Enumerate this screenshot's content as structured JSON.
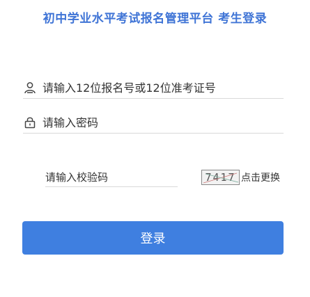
{
  "page": {
    "title": "初中学业水平考试报名管理平台 考生登录"
  },
  "login": {
    "username_placeholder": "请输入12位报名号或12位准考证号",
    "password_placeholder": "请输入密码",
    "captcha_placeholder": "请输入校验码",
    "captcha_code": "7417",
    "refresh_label": "点击更换",
    "submit_label": "登录"
  },
  "colors": {
    "accent": "#3f7fe0",
    "title": "#3f74d6"
  },
  "icons": {
    "username": "user-icon",
    "password": "lock-icon"
  }
}
